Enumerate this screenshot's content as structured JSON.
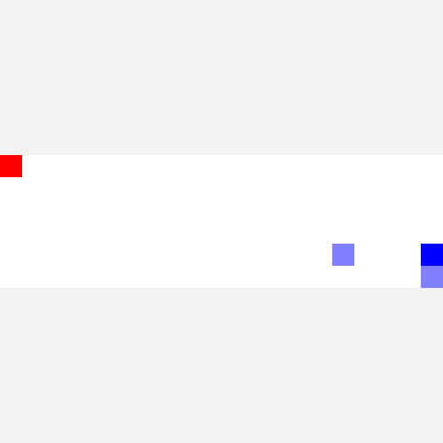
{
  "game": {
    "background_color": "#f2f2f2",
    "board_color": "#ffffff",
    "grid": {
      "columns": 20,
      "rows": 6
    },
    "pieces": [
      {
        "name": "agent-red-block",
        "color": "#ff0000",
        "col": 0,
        "row": 0
      },
      {
        "name": "target-faded-block",
        "color": "#8080ff",
        "col": 15,
        "row": 4
      },
      {
        "name": "player-blue-block",
        "color": "#0000ff",
        "col": 19,
        "row": 4
      },
      {
        "name": "trail-faded-block",
        "color": "#8080ff",
        "col": 19,
        "row": 5
      }
    ]
  }
}
